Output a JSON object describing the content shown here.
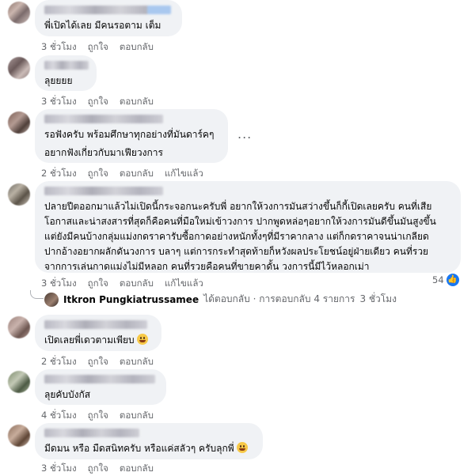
{
  "comments": [
    {
      "text": [
        "พี่เปิดได้เลย มีคนรอตาม เต็ม"
      ],
      "actions": {
        "time": "3 ชั่วโมง",
        "like": "ถูกใจ",
        "reply": "ตอบกลับ"
      }
    },
    {
      "text": [
        "ลุยยยย"
      ],
      "actions": {
        "time": "3 ชั่วโมง",
        "like": "ถูกใจ",
        "reply": "ตอบกลับ"
      }
    },
    {
      "text": [
        "รอฟังครับ พร้อมศึกษาทุกอย่างที่มันดาร์คๆ",
        "อยากฟังเกี่ยวกับมาเฟียวงการ"
      ],
      "actions": {
        "time": "2 ชั่วโมง",
        "like": "ถูกใจ",
        "reply": "ตอบกลับ",
        "edited": "แก้ไขแล้ว"
      }
    },
    {
      "text": [
        "ปลายปีตออกมาแล้วไม่เปิดนี้กระจอกนะครับพี่ อยากให้วงการมันสว่างขึ้นก็กี้เปิดเลยครับ คนที่เสีย",
        "โอกาสและน่าสงสารที่สุดก็คือคนที่มือใหม่เข้าวงการ ปากพูดหล่อๆอยากให้วงการมันดีขึ้นมันสูงขึ้น",
        "แต่ยังมีคนบ้างกลุ่มแม่งกดราคารับซื้อกาดอย่างหนักทั้งๆที่มีราคากลาง แต่ก็กดราคาจนน่าเกลียด",
        "ปากอ้างอยากผลักดันวงการ บลาๆ แต่การกระทำสุดท้ายก็หวังผลประโยชน์อยู่ฝ่ายเดียว คนที่รวย",
        "จากการเล่นกาดแม่งไม่มีหลอก คนที่รวยคือคนที่ขายคาดั้น วงการนี้มีไว้หลอกเม่า"
      ],
      "actions": {
        "time": "3 ชั่วโมง",
        "like": "ถูกใจ",
        "reply": "ตอบกลับ",
        "edited": "แก้ไขแล้ว"
      },
      "reaction_count": "54",
      "reply_summary": {
        "name": "Itkron Pungkiatrussamee",
        "text": "ได้ตอบกลับ · การตอบกลับ 4 รายการ",
        "time": "3 ชั่วโมง"
      }
    },
    {
      "text": [
        "เปิดเลยพี่เดวตามเพียบ"
      ],
      "actions": {
        "time": "2 ชั่วโมง",
        "like": "ถูกใจ",
        "reply": "ตอบกลับ"
      }
    },
    {
      "text": [
        "ลุยคับบังกัส"
      ],
      "actions": {
        "time": "4 ชั่วโมง",
        "like": "ถูกใจ",
        "reply": "ตอบกลับ"
      }
    },
    {
      "text": [
        "มีดมน หรือ มืดสนิทครับ หรือแค่สลัวๆ ครับลุกพี่"
      ],
      "actions": {
        "time": "3 ชั่วโมง",
        "like": "ถูกใจ",
        "reply": "ตอบกลับ"
      }
    }
  ],
  "more_menu": "...",
  "colors": {
    "bubble": "#f0f2f5",
    "meta": "#65676b",
    "like_blue": "#1877f2"
  },
  "icons": [
    "avatar-blurred",
    "like-reaction-icon",
    "grinning-emoji",
    "reply-connector"
  ]
}
